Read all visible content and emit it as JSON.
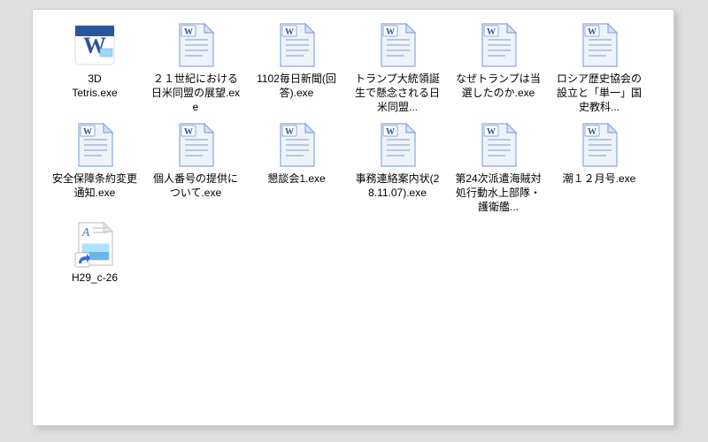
{
  "window": {
    "files": [
      {
        "label": "3D\nTetris.exe",
        "icon": "word",
        "shortcut": false
      },
      {
        "label": "２１世紀における日米同盟の展望.exe",
        "icon": "word-page",
        "shortcut": false
      },
      {
        "label": "1102毎日新聞(回答).exe",
        "icon": "word-page",
        "shortcut": false
      },
      {
        "label": "トランプ大統領誕生で懸念される日米同盟...",
        "icon": "word-page",
        "shortcut": false
      },
      {
        "label": "なぜトランプは当選したのか.exe",
        "icon": "word-page",
        "shortcut": false
      },
      {
        "label": "ロシア歴史協会の設立と「単一」国史教科...",
        "icon": "word-page",
        "shortcut": false
      },
      {
        "label": "安全保障条約変更通知.exe",
        "icon": "word-page",
        "shortcut": false
      },
      {
        "label": "個人番号の提供について.exe",
        "icon": "word-page",
        "shortcut": false
      },
      {
        "label": "懇談会1.exe",
        "icon": "word-page",
        "shortcut": false
      },
      {
        "label": "事務連絡案内状(28.11.07).exe",
        "icon": "word-page",
        "shortcut": false
      },
      {
        "label": "第24次派遣海賊対処行動水上部隊・護衛艦...",
        "icon": "word-page",
        "shortcut": false
      },
      {
        "label": "潮１２月号.exe",
        "icon": "word-page",
        "shortcut": false
      },
      {
        "label": "H29_c-26",
        "icon": "shortcut-doc",
        "shortcut": true
      }
    ]
  },
  "colors": {
    "word_blue": "#2a5699",
    "word_light": "#4a78c8",
    "page_border": "#8aa8da",
    "page_fill": "#eef3fb",
    "line": "#b9c6e0",
    "shortcut_overlay": "#2d6bdb"
  }
}
